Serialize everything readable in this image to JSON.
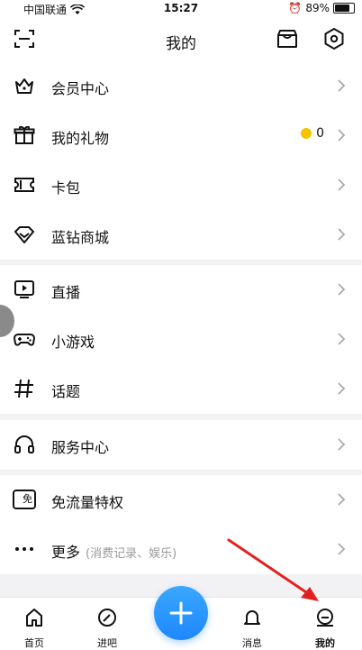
{
  "status_bar": {
    "carrier": "中国联通",
    "time": "15:27",
    "battery": "89%"
  },
  "nav": {
    "title": "我的",
    "left_icon": "scan-icon",
    "right_icons": [
      "store-icon",
      "settings-icon"
    ]
  },
  "sections": [
    {
      "items": [
        {
          "label": "会员中心",
          "icon": "crown-icon"
        },
        {
          "label": "我的礼物",
          "icon": "gift-icon",
          "coin_count": "0"
        },
        {
          "label": "卡包",
          "icon": "ticket-icon"
        },
        {
          "label": "蓝钻商城",
          "icon": "diamond-icon"
        }
      ]
    },
    {
      "items": [
        {
          "label": "直播",
          "icon": "live-icon"
        },
        {
          "label": "小游戏",
          "icon": "gamepad-icon"
        },
        {
          "label": "话题",
          "icon": "hashtag-icon"
        }
      ]
    },
    {
      "items": [
        {
          "label": "服务中心",
          "icon": "headphones-icon"
        }
      ]
    },
    {
      "items": [
        {
          "label": "免流量特权",
          "icon": "free-data-icon",
          "badge": "免"
        },
        {
          "label": "更多",
          "icon": "more-icon",
          "sub": "(消费记录、娱乐)"
        }
      ]
    }
  ],
  "tabs": [
    {
      "label": "首页",
      "icon": "home-icon"
    },
    {
      "label": "进吧",
      "icon": "compass-icon"
    },
    {
      "label": "消息",
      "icon": "bell-icon"
    },
    {
      "label": "我的",
      "icon": "profile-icon"
    }
  ],
  "fab": {
    "icon": "plus-icon",
    "color": "#1e88ff"
  },
  "colors": {
    "accent": "#1e88ff",
    "annotation_arrow": "#e32020",
    "coin": "#f5c400"
  }
}
